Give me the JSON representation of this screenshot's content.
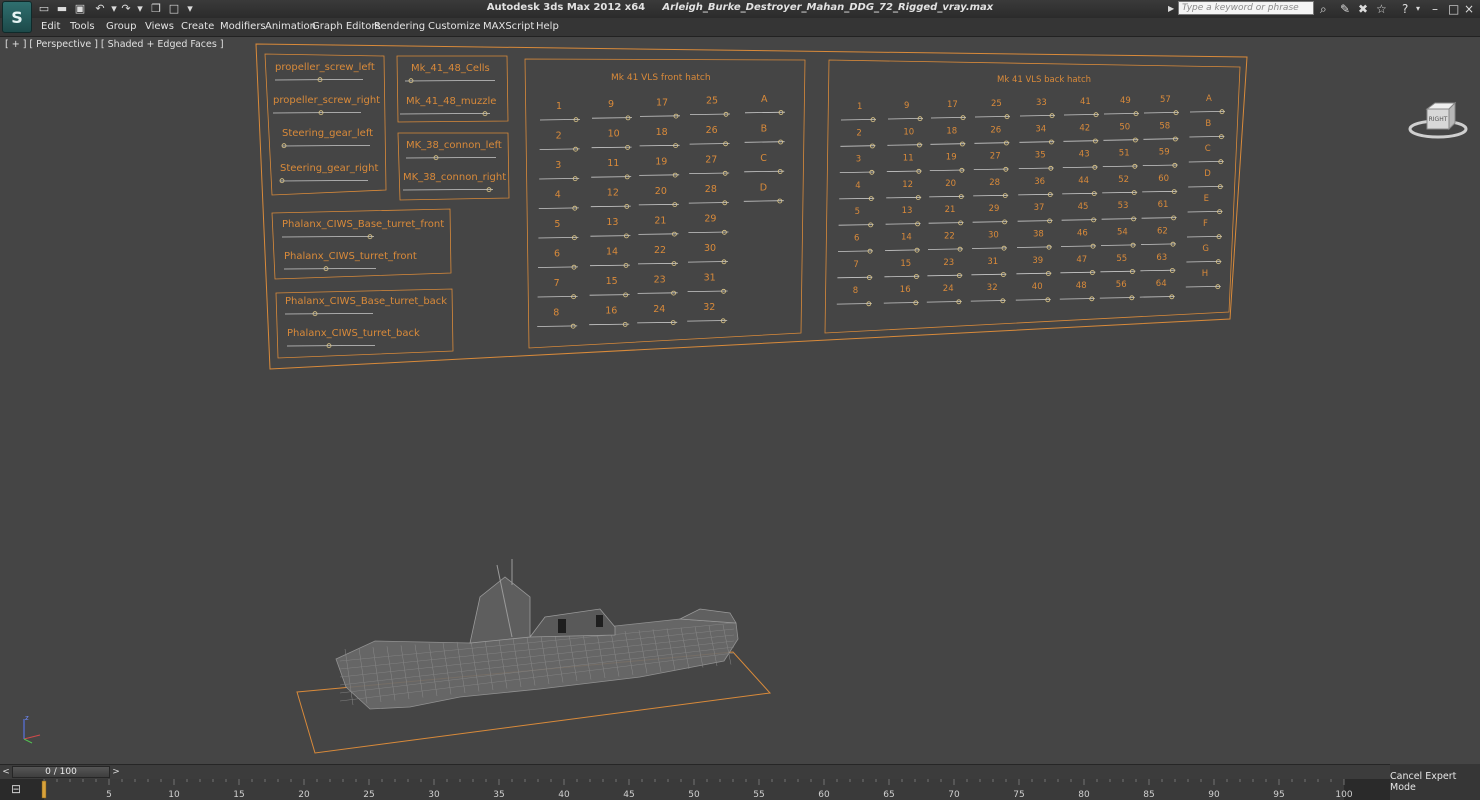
{
  "window": {
    "app_title": "Autodesk 3ds Max  2012 x64",
    "file_title": "Arleigh_Burke_Destroyer_Mahan_DDG_72_Rigged_vray.max",
    "search_placeholder": "Type a keyword or phrase",
    "app_logo": "S"
  },
  "quick_access": {
    "icons": [
      "new-file-icon",
      "open-file-icon",
      "save-icon",
      "undo-icon",
      "redo-icon",
      "project-folder-icon",
      "select-window-icon"
    ]
  },
  "menu": {
    "items": [
      "Edit",
      "Tools",
      "Group",
      "Views",
      "Create",
      "Modifiers",
      "Animation",
      "Graph Editors",
      "Rendering",
      "Customize",
      "MAXScript",
      "Help"
    ]
  },
  "viewport": {
    "label": "[ + ] [ Perspective ] [ Shaded + Edged Faces ]",
    "viewcube_label": "RIGHT"
  },
  "rig_panels": {
    "box_a": [
      "propeller_screw_left",
      "propeller_screw_right",
      "Steering_gear_left",
      "Steering_gear_right"
    ],
    "box_b": [
      "Mk_41_48_Cells",
      "Mk_41_48_muzzle"
    ],
    "box_c": [
      "MK_38_connon_left",
      "MK_38_connon_right"
    ],
    "box_d": [
      "Phalanx_CIWS_Base_turret_front",
      "Phalanx_CIWS_turret_front"
    ],
    "box_e": [
      "Phalanx_CIWS_Base_turret_back",
      "Phalanx_CIWS_turret_back"
    ],
    "vls_front": {
      "title": "Mk 41 VLS front hatch",
      "columns": [
        [
          "1",
          "2",
          "3",
          "4",
          "5",
          "6",
          "7",
          "8"
        ],
        [
          "9",
          "10",
          "11",
          "12",
          "13",
          "14",
          "15",
          "16"
        ],
        [
          "17",
          "18",
          "19",
          "20",
          "21",
          "22",
          "23",
          "24"
        ],
        [
          "25",
          "26",
          "27",
          "28",
          "29",
          "30",
          "31",
          "32"
        ],
        [
          "A",
          "B",
          "C",
          "D"
        ]
      ]
    },
    "vls_back": {
      "title": "Mk 41 VLS back hatch",
      "columns": [
        [
          "1",
          "2",
          "3",
          "4",
          "5",
          "6",
          "7",
          "8"
        ],
        [
          "9",
          "10",
          "11",
          "12",
          "13",
          "14",
          "15",
          "16"
        ],
        [
          "17",
          "18",
          "19",
          "20",
          "21",
          "22",
          "23",
          "24"
        ],
        [
          "25",
          "26",
          "27",
          "28",
          "29",
          "30",
          "31",
          "32"
        ],
        [
          "33",
          "34",
          "35",
          "36",
          "37",
          "38",
          "39",
          "40"
        ],
        [
          "41",
          "42",
          "43",
          "44",
          "45",
          "46",
          "47",
          "48"
        ],
        [
          "49",
          "50",
          "51",
          "52",
          "53",
          "54",
          "55",
          "56"
        ],
        [
          "57",
          "58",
          "59",
          "60",
          "61",
          "62",
          "63",
          "64"
        ],
        [
          "A",
          "B",
          "C",
          "D",
          "E",
          "F",
          "G",
          "H"
        ]
      ]
    }
  },
  "timeline": {
    "frame_display": "0 / 100",
    "ticks": [
      "5",
      "10",
      "15",
      "20",
      "25",
      "30",
      "35",
      "40",
      "45",
      "50",
      "55",
      "60",
      "65",
      "70",
      "75",
      "80",
      "85",
      "90",
      "95",
      "100"
    ],
    "cancel_label": "Cancel Expert Mode"
  },
  "colors": {
    "rig_orange": "#d98a3a",
    "rig_slider": "#c9c9c9",
    "viewport_bg": "#454545",
    "ship_wire": "#9a9a9a"
  }
}
